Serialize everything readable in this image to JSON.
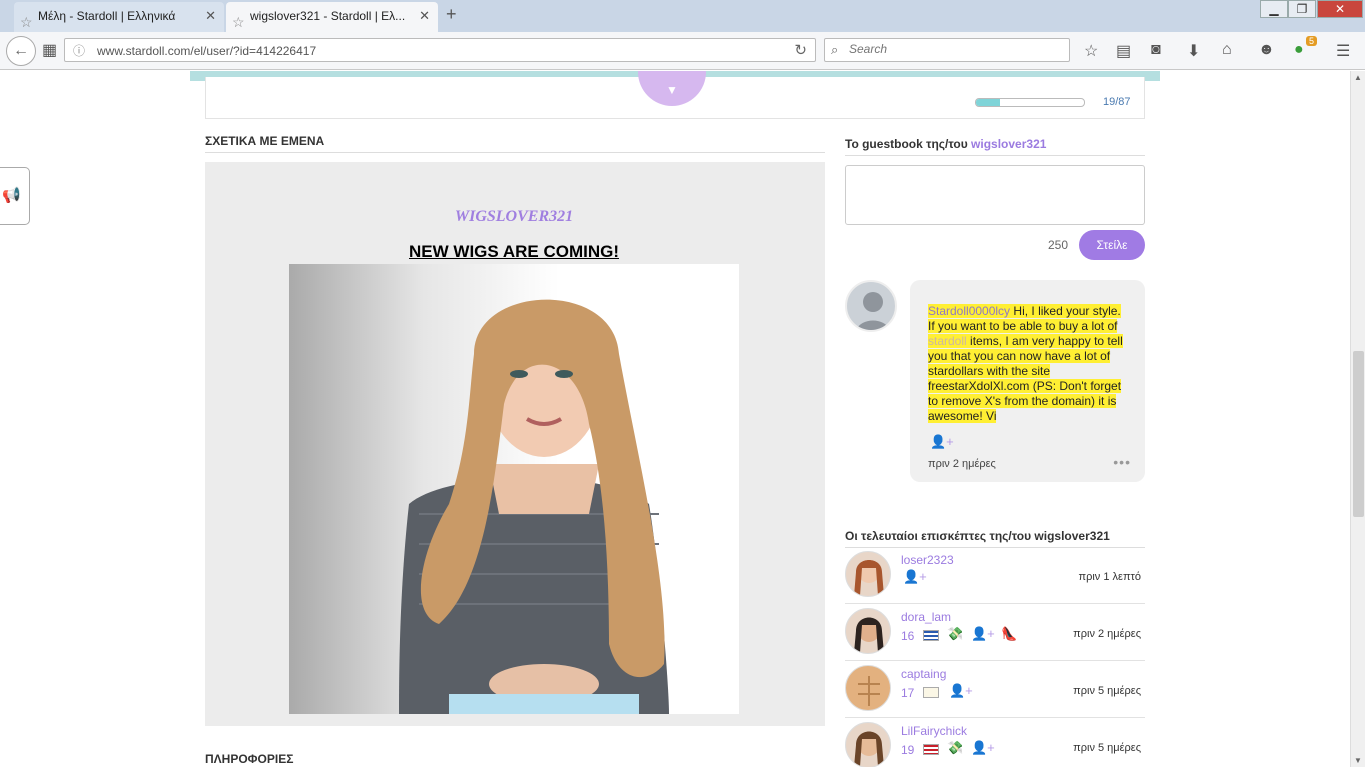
{
  "browser": {
    "tabs": [
      {
        "label": "Μέλη - Stardoll | Ελληνικά",
        "active": false
      },
      {
        "label": "wigslover321 - Stardoll | Ελ...",
        "active": true
      }
    ],
    "new_tab_icon": "plus-icon",
    "url": "www.stardoll.com/el/user/?id=414226417",
    "search_placeholder": "Search",
    "extension_badge": "5",
    "window_controls": {
      "minimize": "▁",
      "maximize": "❐",
      "close": "✕"
    }
  },
  "page": {
    "progress": {
      "fraction": 0.225,
      "text": "19/87"
    },
    "about": {
      "title": "ΣΧΕΤΙΚΑ ΜΕ ΕΜΕΝΑ",
      "name": "WIGSLOVER321",
      "headline": "NEW WIGS ARE COMING!"
    },
    "guestbook": {
      "title_prefix": "To guestbook της/του ",
      "title_user": "wigslover321",
      "char_count": "250",
      "send_label": "Στείλε",
      "entry": {
        "author": "Stardoll0000lcy",
        "text_part1": " Hi, I liked your style. If you want to be able to buy a lot of ",
        "keyword": "stardoll",
        "text_part2": " items, I am very happy to tell you that you can now have a lot of stardollars with the site freestarXdolXl.com (PS: Don't forget to remove X's from the domain)  it is awesome! Vi",
        "time": "πριν 2 ημέρες"
      }
    },
    "visitors": {
      "title": "Οι τελευταίοι επισκέπτες της/του wigslover321",
      "items": [
        {
          "name": "loser2323",
          "level": "",
          "time": "πριν 1 λεπτό"
        },
        {
          "name": "dora_lam",
          "level": "16",
          "time": "πριν 2 ημέρες"
        },
        {
          "name": "captaing",
          "level": "17",
          "time": "πριν 5 ημέρες"
        },
        {
          "name": "LilFairychick",
          "level": "19",
          "time": "πριν 5 ημέρες"
        }
      ]
    },
    "info_title": "ΠΛΗΡΟΦΟΡΙΕΣ"
  },
  "colors": {
    "accent": "#a07be4",
    "highlight": "#ffef33",
    "link": "#9b7be0",
    "tabbar": "#c9d6e6"
  }
}
